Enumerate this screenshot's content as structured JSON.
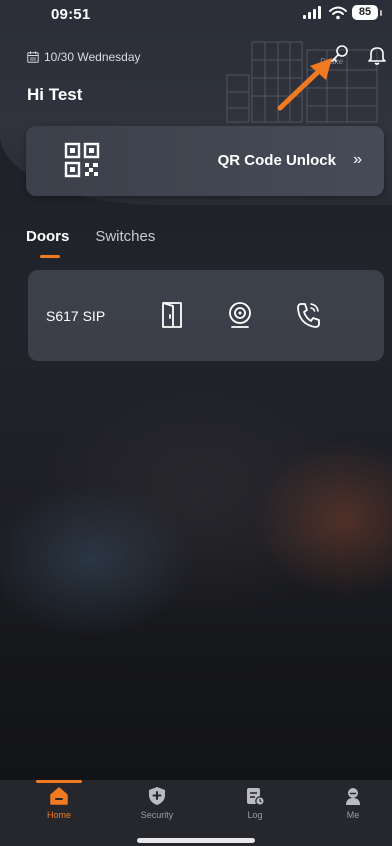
{
  "status_bar": {
    "time": "09:51",
    "battery": "85"
  },
  "header": {
    "date": "10/30 Wednesday",
    "greeting": "Hi Test",
    "brand_watermark": "Dnake"
  },
  "qr_card": {
    "label": "QR Code Unlock",
    "chevron": "»"
  },
  "tabs": [
    {
      "label": "Doors",
      "active": true
    },
    {
      "label": "Switches",
      "active": false
    }
  ],
  "doors": [
    {
      "name": "S617 SIP",
      "actions": [
        "door-unlock-icon",
        "camera-icon",
        "phone-call-icon"
      ]
    }
  ],
  "bottom_nav": [
    {
      "label": "Home",
      "icon": "home-icon",
      "active": true
    },
    {
      "label": "Security",
      "icon": "shield-plus-icon",
      "active": false
    },
    {
      "label": "Log",
      "icon": "log-icon",
      "active": false
    },
    {
      "label": "Me",
      "icon": "user-icon",
      "active": false
    }
  ],
  "colors": {
    "accent": "#f07a22",
    "card": "#464a56",
    "background": "#1c1e26"
  }
}
